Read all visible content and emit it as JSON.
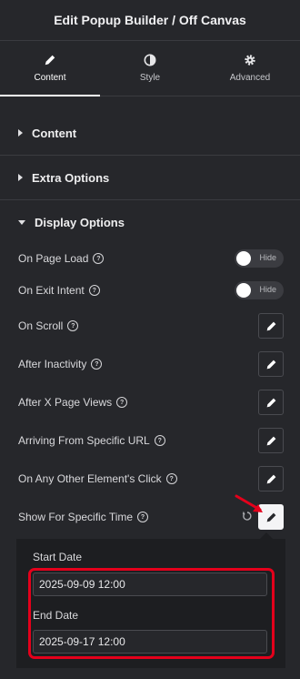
{
  "header": {
    "title": "Edit Popup Builder / Off Canvas"
  },
  "tabs": [
    {
      "label": "Content",
      "icon": "pencil-icon"
    },
    {
      "label": "Style",
      "icon": "half-circle-icon"
    },
    {
      "label": "Advanced",
      "icon": "gear-icon"
    }
  ],
  "sections": {
    "content": "Content",
    "extra": "Extra Options",
    "display": "Display Options"
  },
  "display_options": {
    "on_page_load": {
      "label": "On Page Load",
      "toggle": "Hide"
    },
    "on_exit_intent": {
      "label": "On Exit Intent",
      "toggle": "Hide"
    },
    "on_scroll": "On Scroll",
    "after_inactivity": "After Inactivity",
    "after_page_views": "After X Page Views",
    "arriving_url": "Arriving From Specific URL",
    "element_click": "On Any Other Element's Click",
    "specific_time": "Show For Specific Time"
  },
  "popup": {
    "start_label": "Start Date",
    "start_value": "2025-09-09 12:00",
    "end_label": "End Date",
    "end_value": "2025-09-17 12:00"
  },
  "colors": {
    "background": "#26272b",
    "highlight": "#e4001b"
  }
}
